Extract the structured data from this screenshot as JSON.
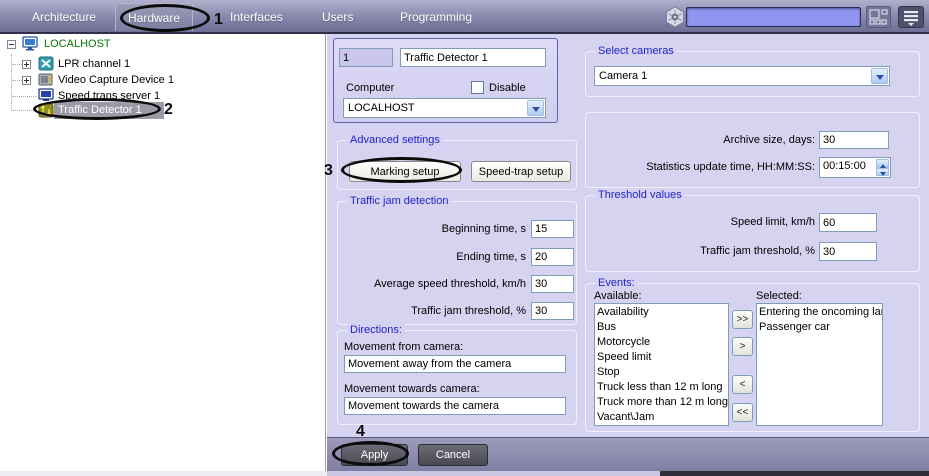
{
  "topbar": {
    "tabs": [
      {
        "label": "Architecture"
      },
      {
        "label": "Hardware"
      },
      {
        "label": "Interfaces"
      },
      {
        "label": "Users"
      },
      {
        "label": "Programming"
      }
    ],
    "search": {
      "value": ""
    },
    "icons": {
      "logo": "hexagon-nut-icon",
      "layout": "grid-layout-icon",
      "menu": "hamburger-menu-icon"
    }
  },
  "tree": {
    "items": [
      {
        "label": "LOCALHOST",
        "icon": "computer-icon",
        "expanded": true
      },
      {
        "label": "LPR channel 1",
        "icon": "lpr-channel-icon",
        "collapsed": true
      },
      {
        "label": "Video Capture Device 1",
        "icon": "video-capture-icon",
        "collapsed": true
      },
      {
        "label": "Speed trans server 1",
        "icon": "speed-server-icon"
      },
      {
        "label": "Traffic Detector 1",
        "icon": "traffic-detector-icon",
        "selected": true
      }
    ]
  },
  "settings": {
    "id_value": "1",
    "name_value": "Traffic Detector 1",
    "computer_label": "Computer",
    "disable_label": "Disable",
    "computer_value": "LOCALHOST",
    "advanced": {
      "title": "Advanced settings",
      "marking_button": "Marking setup",
      "speedtrap_button": "Speed-trap setup"
    },
    "traffic_jam": {
      "title": "Traffic jam detection",
      "fields": [
        {
          "label": "Beginning time, s",
          "value": "15"
        },
        {
          "label": "Ending time, s",
          "value": "20"
        },
        {
          "label": "Average speed threshold, km/h",
          "value": "30"
        },
        {
          "label": "Traffic jam threshold, %",
          "value": "30"
        }
      ]
    },
    "directions": {
      "title": "Directions:",
      "from_label": "Movement from camera:",
      "from_value": "Movement away from the camera",
      "towards_label": "Movement towards camera:",
      "towards_value": "Movement towards the camera"
    },
    "cameras": {
      "title": "Select cameras",
      "value": "Camera 1"
    },
    "archive": {
      "size_label": "Archive size, days:",
      "size_value": "30",
      "stats_label": "Statistics update time, HH:MM:SS:",
      "stats_value": "00:15:00"
    },
    "thresholds": {
      "title": "Threshold values",
      "speed_label": "Speed limit, km/h",
      "speed_value": "60",
      "jam_label": "Traffic jam threshold, %",
      "jam_value": "30"
    },
    "events": {
      "title": "Events:",
      "available_label": "Available:",
      "selected_label": "Selected:",
      "available": [
        "Availability",
        "Bus",
        "Motorcycle",
        "Speed limit",
        "Stop",
        "Truck less than 12 m long",
        "Truck more than 12 m long",
        "Vacant\\Jam"
      ],
      "selected": [
        "Entering the oncoming lane",
        "Passenger car"
      ],
      "buttons": {
        "add_all": ">>",
        "add": ">",
        "remove": "<",
        "remove_all": "<<"
      }
    },
    "apply_label": "Apply",
    "cancel_label": "Cancel"
  },
  "annotations": {
    "callouts": [
      {
        "number": "1"
      },
      {
        "number": "2"
      },
      {
        "number": "3"
      },
      {
        "number": "4"
      }
    ]
  },
  "colors": {
    "panel_lavender": "#d6d3f0",
    "group_label_blue": "#2323cc",
    "tree_localhost_green": "#067806",
    "selection_gray": "#9b9aa6",
    "search_fill_blue": "#8e96f0"
  }
}
